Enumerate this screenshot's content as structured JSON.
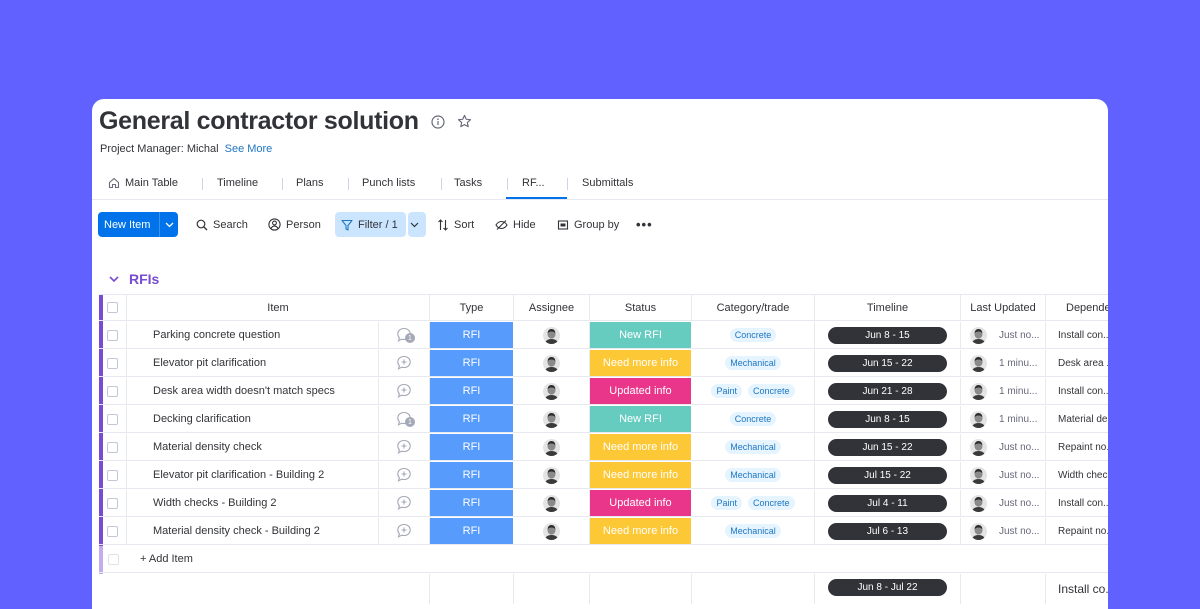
{
  "board": {
    "title": "General contractor solution",
    "project_manager": "Project Manager: Michal",
    "see_more": "See More",
    "icons": [
      "info-icon",
      "star-icon"
    ]
  },
  "tabs": [
    {
      "label": "Main Table",
      "icon": "home-icon"
    },
    {
      "label": "Timeline"
    },
    {
      "label": "Plans"
    },
    {
      "label": "Punch lists"
    },
    {
      "label": "Tasks"
    },
    {
      "label": "RF...",
      "active": true
    },
    {
      "label": "Submittals"
    }
  ],
  "toolbar": {
    "new_item": "New Item",
    "search": "Search",
    "person": "Person",
    "filter": "Filter / 1",
    "sort": "Sort",
    "hide": "Hide",
    "group_by": "Group by",
    "more": "•••"
  },
  "group": {
    "title": "RFIs",
    "color": "#784bd1",
    "columns": [
      "Item",
      "Type",
      "Assignee",
      "Status",
      "Category/trade",
      "Timeline",
      "Last Updated",
      "Depende..."
    ],
    "rows": [
      {
        "item": "Parking concrete question",
        "updates": "1",
        "type": "RFI",
        "status": "New RFI",
        "status_color": "#66ccc0",
        "categories": [
          "Concrete"
        ],
        "timeline": "Jun 8 - 15",
        "last_updated": "Just no...",
        "dependency": "Install con..."
      },
      {
        "item": "Elevator pit clarification",
        "updates": "",
        "type": "RFI",
        "status": "Need more info",
        "status_color": "#fdc836",
        "categories": [
          "Mechanical"
        ],
        "timeline": "Jun 15 - 22",
        "last_updated": "1 minu...",
        "dependency": "Desk area ..."
      },
      {
        "item": "Desk area width doesn't match specs",
        "updates": "",
        "type": "RFI",
        "status": "Updated info",
        "status_color": "#e9368b",
        "categories": [
          "Paint",
          "Concrete"
        ],
        "timeline": "Jun 21 - 28",
        "last_updated": "1 minu...",
        "dependency": "Install con..."
      },
      {
        "item": "Decking clarification",
        "updates": "1",
        "type": "RFI",
        "status": "New RFI",
        "status_color": "#66ccc0",
        "categories": [
          "Concrete"
        ],
        "timeline": "Jun 8 - 15",
        "last_updated": "1 minu...",
        "dependency": "Material de..."
      },
      {
        "item": "Material density check",
        "updates": "",
        "type": "RFI",
        "status": "Need more info",
        "status_color": "#fdc836",
        "categories": [
          "Mechanical"
        ],
        "timeline": "Jun 15 - 22",
        "last_updated": "Just no...",
        "dependency": "Repaint no..."
      },
      {
        "item": "Elevator pit clarification - Building 2",
        "updates": "",
        "type": "RFI",
        "status": "Need more info",
        "status_color": "#fdc836",
        "categories": [
          "Mechanical"
        ],
        "timeline": "Jul 15 - 22",
        "last_updated": "Just no...",
        "dependency": "Width chec..."
      },
      {
        "item": "Width checks - Building 2",
        "updates": "",
        "type": "RFI",
        "status": "Updated info",
        "status_color": "#e9368b",
        "categories": [
          "Paint",
          "Concrete"
        ],
        "timeline": "Jul 4 - 11",
        "last_updated": "Just no...",
        "dependency": "Install con..."
      },
      {
        "item": "Material density check - Building 2",
        "updates": "",
        "type": "RFI",
        "status": "Need more info",
        "status_color": "#fdc836",
        "categories": [
          "Mechanical"
        ],
        "timeline": "Jul 6 - 13",
        "last_updated": "Just no...",
        "dependency": "Repaint no..."
      }
    ],
    "add_item": "+ Add Item",
    "summary": {
      "timeline": "Jun 8 - Jul 22",
      "dependency": "Install co..."
    }
  }
}
